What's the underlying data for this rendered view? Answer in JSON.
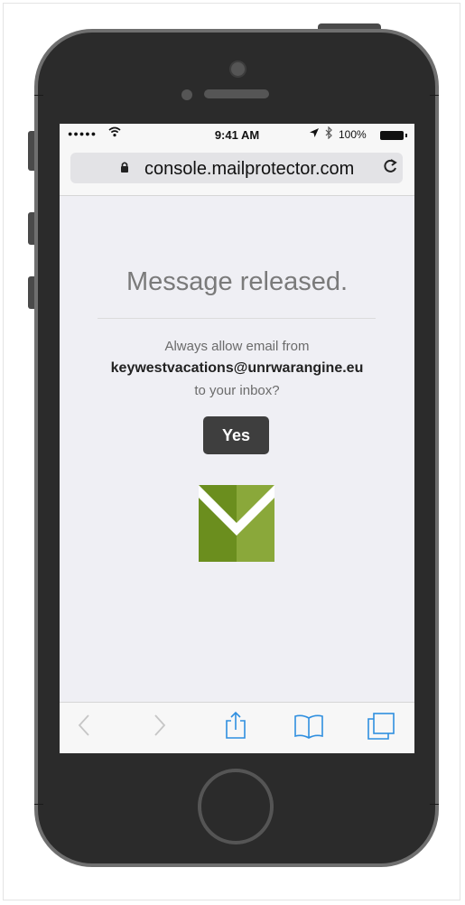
{
  "status_bar": {
    "signal": "●●●●●",
    "time": "9:41 AM",
    "battery": "100%"
  },
  "browser": {
    "url": "console.mailprotector.com"
  },
  "page": {
    "title": "Message released.",
    "prompt_line1": "Always allow email from",
    "sender_email": "keywestvacations@unrwarangine.eu",
    "prompt_line2": "to your inbox?",
    "yes_button": "Yes"
  },
  "icons": {
    "wifi": "wifi-icon",
    "location": "location-arrow-icon",
    "bluetooth": "bluetooth-icon",
    "battery": "battery-icon",
    "lock": "lock-icon",
    "reload": "reload-icon",
    "back": "chevron-left-icon",
    "forward": "chevron-right-icon",
    "share": "share-icon",
    "bookmarks": "book-icon",
    "tabs": "tabs-icon",
    "logo": "mailprotector-logo"
  },
  "colors": {
    "toolbar_icon_blue": "#2f8fe0",
    "logo_green_dark": "#6b8e1e",
    "logo_green_light": "#8aa83a",
    "button_bg": "#3e3e3e"
  }
}
